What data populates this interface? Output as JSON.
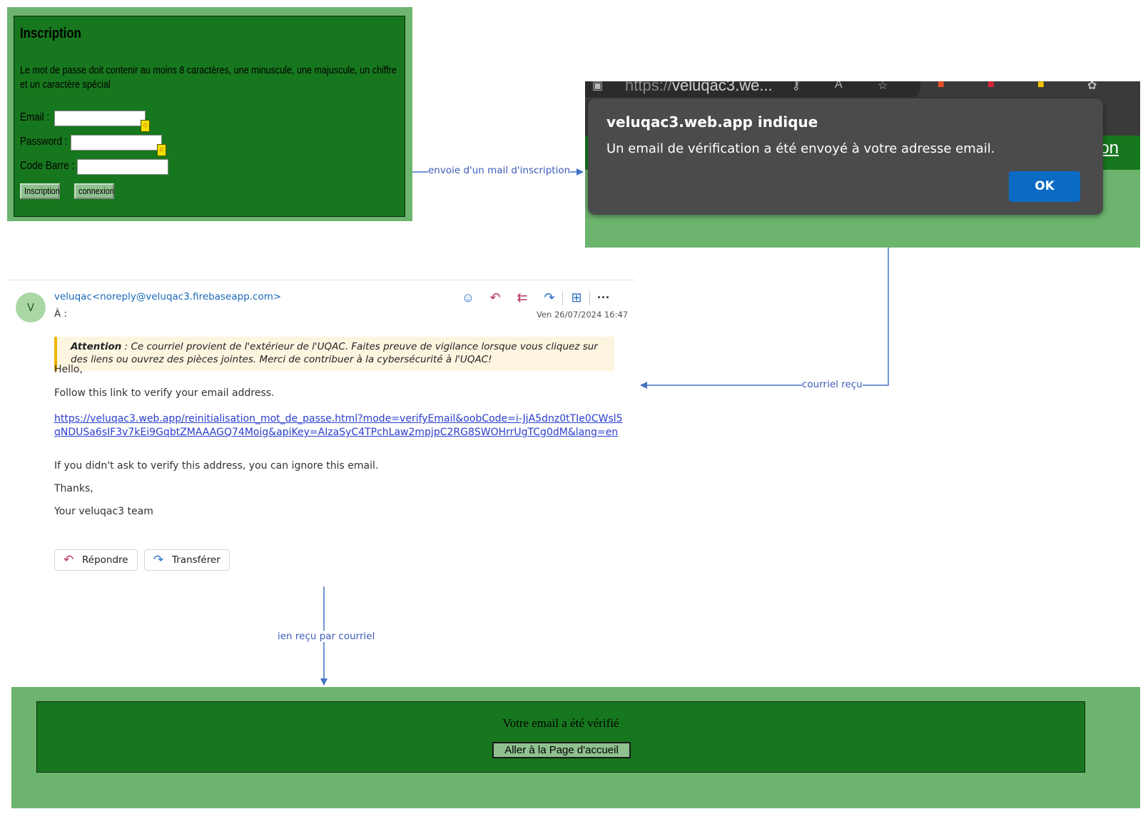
{
  "inscription": {
    "title": "Inscription",
    "description": "Le mot de passe doit contenir au moins 8 caractères, une minuscule, une majuscule, un chiffre et un caractère spécial",
    "email_label": "Email :",
    "password_label": "Password :",
    "barcode_label": "Code Barre :",
    "inscription_button": "Inscription",
    "connexion_button": "connexion"
  },
  "alert": {
    "url_prefix": "https://",
    "url_host": "veluqac3.we...",
    "title": "veluqac3.web.app indique",
    "message": "Un email de vérification a été envoyé à votre adresse email.",
    "ok_label": "OK",
    "bg_link_partial": "xion"
  },
  "email": {
    "avatar_letter": "V",
    "from": "veluqac<noreply@veluqac3.firebaseapp.com>",
    "to_label": "À :",
    "date": "Ven 26/07/2024 16:47",
    "warning_strong": "Attention",
    "warning_text": " : Ce courriel provient de l'extérieur de l'UQAC. Faites preuve de vigilance lorsque vous cliquez sur des liens ou ouvrez des pièces jointes. Merci de contribuer à la cybersécurité à l'UQAC!",
    "greeting": "Hello,",
    "line1": "Follow this link to verify your email address.",
    "link": "https://veluqac3.web.app/reinitialisation_mot_de_passe.html?mode=verifyEmail&oobCode=i-JjA5dnz0tTIe0CWsl5qNDUSa6sIF3v7kEi9GqbtZMAAAGQ74Moig&apiKey=AIzaSyC4TPchLaw2mpjpC2RG8SWOHrrUgTCg0dM&lang=en",
    "line2": "If you didn't ask to verify this address, you can ignore this email.",
    "thanks": "Thanks,",
    "signature": "Your veluqac3 team",
    "reply_button": "Répondre",
    "forward_button": "Transférer",
    "more_icon": "···"
  },
  "verified": {
    "message": "Votre email a été vérifié",
    "button": "Aller à la Page d'accueil"
  },
  "arrows": {
    "a1": "envoie d'un mail d'inscription",
    "a2": "courriel reçu",
    "a3": "ien reçu par courriel"
  },
  "colors": {
    "panel_light_green": "#6db56f",
    "panel_dark_green": "#17771e",
    "arrow_blue": "#4472c4",
    "ok_blue": "#0b6ac4"
  }
}
